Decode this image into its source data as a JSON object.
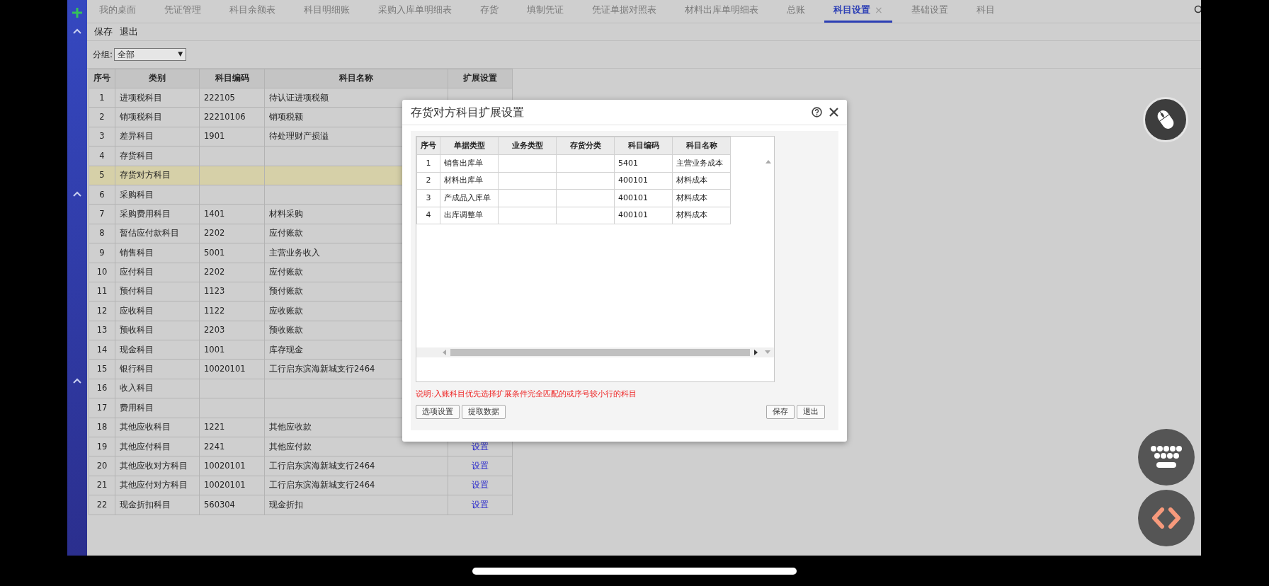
{
  "tabs": [
    {
      "label": "我的桌面",
      "selected": false
    },
    {
      "label": "凭证管理",
      "selected": false
    },
    {
      "label": "科目余额表",
      "selected": false
    },
    {
      "label": "科目明细账",
      "selected": false
    },
    {
      "label": "采购入库单明细表",
      "selected": false
    },
    {
      "label": "存货",
      "selected": false
    },
    {
      "label": "填制凭证",
      "selected": false
    },
    {
      "label": "凭证单据对照表",
      "selected": false
    },
    {
      "label": "材料出库单明细表",
      "selected": false
    },
    {
      "label": "总账",
      "selected": false
    },
    {
      "label": "科目设置",
      "selected": true,
      "close_glyph": "×"
    },
    {
      "label": "基础设置",
      "selected": false
    },
    {
      "label": "科目",
      "selected": false
    }
  ],
  "toolbar": [
    "保存",
    "退出"
  ],
  "group_filter": {
    "label": "分组:",
    "value": "全部",
    "caret": "▼"
  },
  "table": {
    "columns": [
      "序号",
      "类别",
      "科目编码",
      "科目名称",
      "扩展设置"
    ],
    "rows": [
      {
        "no": "1",
        "category": "进项税科目",
        "code": "222105",
        "name": "待认证进项税额",
        "selected": false
      },
      {
        "no": "2",
        "category": "销项税科目",
        "code": "22210106",
        "name": "销项税额",
        "selected": false
      },
      {
        "no": "3",
        "category": "差异科目",
        "code": "1901",
        "name": "待处理财产损溢",
        "selected": false
      },
      {
        "no": "4",
        "category": "存货科目",
        "selected": false
      },
      {
        "no": "5",
        "category": "存货对方科目",
        "selected": true
      },
      {
        "no": "6",
        "category": "采购科目",
        "selected": false
      },
      {
        "no": "7",
        "category": "采购费用科目",
        "code": "1401",
        "name": "材料采购",
        "selected": false
      },
      {
        "no": "8",
        "category": "暂估应付款科目",
        "code": "2202",
        "name": "应付账款",
        "selected": false
      },
      {
        "no": "9",
        "category": "销售科目",
        "code": "5001",
        "name": "主营业务收入",
        "selected": false
      },
      {
        "no": "10",
        "category": "应付科目",
        "code": "2202",
        "name": "应付账款",
        "selected": false
      },
      {
        "no": "11",
        "category": "预付科目",
        "code": "1123",
        "name": "预付账款",
        "selected": false
      },
      {
        "no": "12",
        "category": "应收科目",
        "code": "1122",
        "name": "应收账款",
        "selected": false
      },
      {
        "no": "13",
        "category": "预收科目",
        "code": "2203",
        "name": "预收账款",
        "selected": false
      },
      {
        "no": "14",
        "category": "现金科目",
        "code": "1001",
        "name": "库存现金",
        "selected": false
      },
      {
        "no": "15",
        "category": "银行科目",
        "code": "10020101",
        "name": "工行启东滨海新城支行2464",
        "selected": false
      },
      {
        "no": "16",
        "category": "收入科目",
        "selected": false
      },
      {
        "no": "17",
        "category": "费用科目",
        "selected": false
      },
      {
        "no": "18",
        "category": "其他应收科目",
        "code": "1221",
        "name": "其他应收款",
        "selected": false
      },
      {
        "no": "19",
        "category": "其他应付科目",
        "code": "2241",
        "name": "其他应付款",
        "link": "设置",
        "selected": false
      },
      {
        "no": "20",
        "category": "其他应收对方科目",
        "code": "10020101",
        "name": "工行启东滨海新城支行2464",
        "link": "设置",
        "selected": false
      },
      {
        "no": "21",
        "category": "其他应付对方科目",
        "code": "10020101",
        "name": "工行启东滨海新城支行2464",
        "link": "设置",
        "selected": false
      },
      {
        "no": "22",
        "category": "现金折扣科目",
        "code": "560304",
        "name": "现金折扣",
        "link": "设置",
        "selected": false
      }
    ]
  },
  "dialog": {
    "title": "存货对方科目扩展设置",
    "columns": [
      "序号",
      "单据类型",
      "业务类型",
      "存货分类",
      "科目编码",
      "科目名称"
    ],
    "rows": [
      [
        "1",
        "销售出库单",
        "",
        "",
        "5401",
        "主营业务成本"
      ],
      [
        "2",
        "材料出库单",
        "",
        "",
        "400101",
        "材料成本"
      ],
      [
        "3",
        "产成品入库单",
        "",
        "",
        "400101",
        "材料成本"
      ],
      [
        "4",
        "出库调整单",
        "",
        "",
        "400101",
        "材料成本"
      ]
    ],
    "note": "说明:入账科目优先选择扩展条件完全匹配的或序号较小行的科目",
    "left_buttons": [
      "选项设置",
      "提取数据"
    ],
    "right_buttons": [
      "保存",
      "退出"
    ]
  }
}
